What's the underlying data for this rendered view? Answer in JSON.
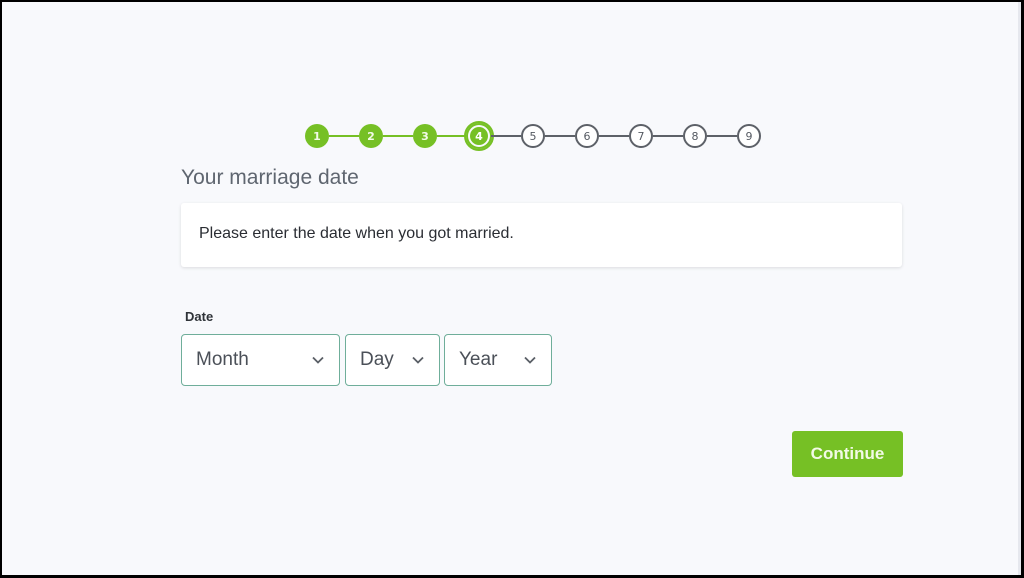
{
  "stepper": {
    "current_step": 4,
    "total_steps": 9,
    "steps": [
      {
        "label": "1",
        "status": "done"
      },
      {
        "label": "2",
        "status": "done"
      },
      {
        "label": "3",
        "status": "done"
      },
      {
        "label": "4",
        "status": "current"
      },
      {
        "label": "5",
        "status": "todo"
      },
      {
        "label": "6",
        "status": "todo"
      },
      {
        "label": "7",
        "status": "todo"
      },
      {
        "label": "8",
        "status": "todo"
      },
      {
        "label": "9",
        "status": "todo"
      }
    ]
  },
  "page": {
    "title": "Your marriage date",
    "instruction": "Please enter the date when you got married."
  },
  "form": {
    "date_label": "Date",
    "month": {
      "value": "Month",
      "icon": "chevron-down-icon"
    },
    "day": {
      "value": "Day",
      "icon": "chevron-down-icon"
    },
    "year": {
      "value": "Year",
      "icon": "chevron-down-icon"
    }
  },
  "actions": {
    "continue_label": "Continue"
  },
  "colors": {
    "accent": "#76c025",
    "select_border": "#6fae9a",
    "inactive_step": "#5d6168",
    "background": "#f8f9fc"
  }
}
